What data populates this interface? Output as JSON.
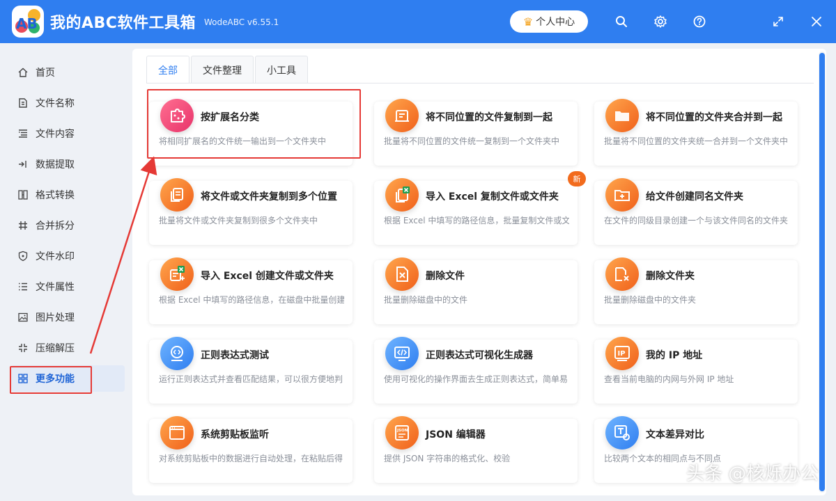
{
  "app": {
    "title": "我的ABC软件工具箱",
    "version": "WodeABC v6.55.1",
    "logo_text": "AB",
    "user_center": "个人中心"
  },
  "titlebar_icons": [
    "search-icon",
    "gear-icon",
    "help-icon",
    "maximize-icon",
    "close-icon"
  ],
  "sidebar": {
    "items": [
      {
        "label": "首页",
        "icon": "home-icon"
      },
      {
        "label": "文件名称",
        "icon": "file-name-icon"
      },
      {
        "label": "文件内容",
        "icon": "file-content-icon"
      },
      {
        "label": "数据提取",
        "icon": "data-extract-icon"
      },
      {
        "label": "格式转换",
        "icon": "format-convert-icon"
      },
      {
        "label": "合并拆分",
        "icon": "merge-split-icon"
      },
      {
        "label": "文件水印",
        "icon": "watermark-icon"
      },
      {
        "label": "文件属性",
        "icon": "file-attr-icon"
      },
      {
        "label": "图片处理",
        "icon": "image-icon"
      },
      {
        "label": "压缩解压",
        "icon": "compress-icon"
      },
      {
        "label": "更多功能",
        "icon": "more-icon",
        "active": true
      }
    ]
  },
  "tabs": [
    {
      "label": "全部",
      "active": true
    },
    {
      "label": "文件整理"
    },
    {
      "label": "小工具"
    }
  ],
  "cards": [
    {
      "title": "按扩展名分类",
      "desc": "将相同扩展名的文件统一输出到一个文件夹中",
      "icon": "puzzle-icon",
      "color": "pink"
    },
    {
      "title": "将不同位置的文件复制到一起",
      "desc": "批量将不同位置的文件统一复制到一个文件夹中",
      "icon": "file-copy-icon",
      "color": "orange"
    },
    {
      "title": "将不同位置的文件夹合并到一起",
      "desc": "批量将不同位置的文件夹统一合并到一个文件夹中",
      "icon": "folder-icon",
      "color": "orange"
    },
    {
      "title": "将文件或文件夹复制到多个位置",
      "desc": "批量将文件或文件夹复制到很多个文件夹中",
      "icon": "multi-copy-icon",
      "color": "orange"
    },
    {
      "title": "导入 Excel 复制文件或文件夹",
      "desc": "根据 Excel 中填写的路径信息，批量复制文件或文(",
      "icon": "excel-copy-icon",
      "color": "orange",
      "badge": "新"
    },
    {
      "title": "给文件创建同名文件夹",
      "desc": "在文件的同级目录创建一个与该文件同名的文件夹",
      "icon": "folder-add-icon",
      "color": "orange"
    },
    {
      "title": "导入 Excel 创建文件或文件夹",
      "desc": "根据 Excel 中填写的路径信息，在磁盘中批量创建̀",
      "icon": "excel-create-icon",
      "color": "orange"
    },
    {
      "title": "删除文件",
      "desc": "批量删除磁盘中的文件",
      "icon": "file-delete-icon",
      "color": "orange"
    },
    {
      "title": "删除文件夹",
      "desc": "批量删除磁盘中的文件夹",
      "icon": "folder-delete-icon",
      "color": "orange"
    },
    {
      "title": "正则表达式测试",
      "desc": "运行正则表达式并查看匹配结果，可以很方便地判",
      "icon": "regex-test-icon",
      "color": "blue"
    },
    {
      "title": "正则表达式可视化生成器",
      "desc": "使用可视化的操作界面去生成正则表达式，简单易",
      "icon": "regex-builder-icon",
      "color": "blue"
    },
    {
      "title": "我的 IP 地址",
      "desc": "查看当前电脑的内网与外网 IP 地址",
      "icon": "ip-icon",
      "color": "orange"
    },
    {
      "title": "系统剪贴板监听",
      "desc": "对系统剪贴板中的数据进行自动处理，在粘贴后得",
      "icon": "clipboard-icon",
      "color": "orange"
    },
    {
      "title": "JSON 编辑器",
      "desc": "提供 JSON 字符串的格式化、校验",
      "icon": "json-icon",
      "color": "orange"
    },
    {
      "title": "文本差异对比",
      "desc": "比较两个文本的相同点与不同点",
      "icon": "text-diff-icon",
      "color": "blue"
    }
  ],
  "watermark": "头条 @核烁办公"
}
